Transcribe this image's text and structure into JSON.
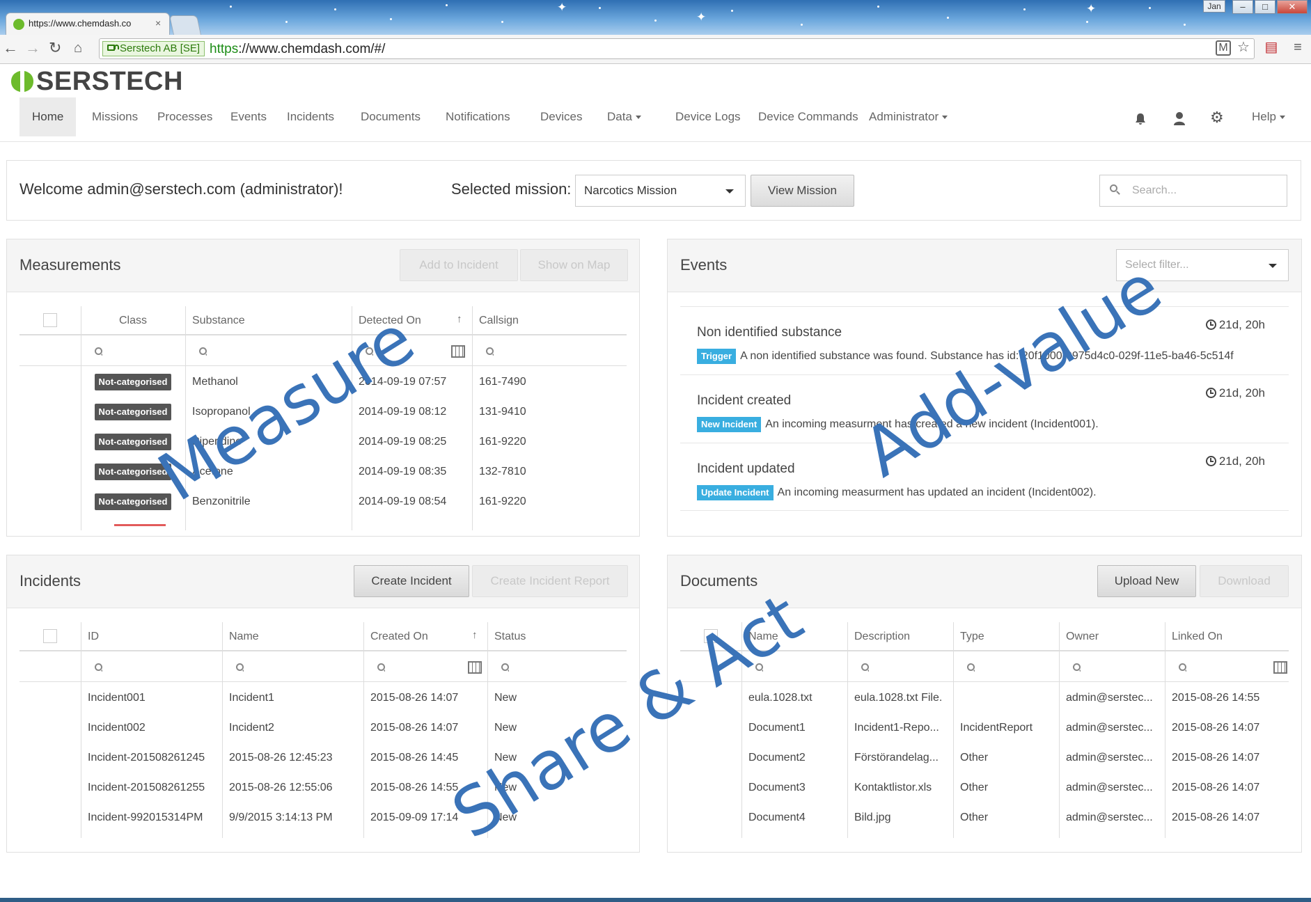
{
  "browser": {
    "tab_title": "https://www.chemdash.co",
    "tab_close": "×",
    "window_user": "Jan",
    "cert_label": "Serstech AB [SE]",
    "url_scheme": "https",
    "url_rest": "://www.chemdash.com/#/"
  },
  "app": {
    "logo_text": "SERSTECH",
    "brand_color": "#6dbb2c",
    "nav": [
      {
        "label": "Home",
        "active": true
      },
      {
        "label": "Missions"
      },
      {
        "label": "Processes"
      },
      {
        "label": "Events"
      },
      {
        "label": "Incidents"
      },
      {
        "label": "Documents"
      },
      {
        "label": "Notifications"
      },
      {
        "label": "Devices"
      },
      {
        "label": "Data",
        "dropdown": true
      },
      {
        "label": "Device Logs"
      },
      {
        "label": "Device Commands"
      },
      {
        "label": "Administrator",
        "dropdown": true
      }
    ],
    "help_label": "Help",
    "header_icons": [
      "bell-icon",
      "user-icon",
      "gear-icon"
    ]
  },
  "welcome": {
    "text": "Welcome admin@serstech.com (administrator)!",
    "mission_label": "Selected mission:",
    "mission_value": "Narcotics Mission",
    "view_mission": "View Mission",
    "search_placeholder": "Search..."
  },
  "measurements": {
    "title": "Measurements",
    "add_to_incident": "Add to Incident",
    "show_on_map": "Show on Map",
    "columns": [
      "Class",
      "Substance",
      "Detected On",
      "Callsign"
    ],
    "rows": [
      {
        "class": "Not-categorised",
        "substance": "Methanol",
        "detected": "2014-09-19 07:57",
        "callsign": "161-7490"
      },
      {
        "class": "Not-categorised",
        "substance": "Isopropanol",
        "detected": "2014-09-19 08:12",
        "callsign": "131-9410"
      },
      {
        "class": "Not-categorised",
        "substance": "Piperidine",
        "detected": "2014-09-19 08:25",
        "callsign": "161-9220"
      },
      {
        "class": "Not-categorised",
        "substance": "Acetone",
        "detected": "2014-09-19 08:35",
        "callsign": "132-7810"
      },
      {
        "class": "Not-categorised",
        "substance": "Benzonitrile",
        "detected": "2014-09-19 08:54",
        "callsign": "161-9220"
      }
    ]
  },
  "events": {
    "title": "Events",
    "filter_placeholder": "Select filter...",
    "items": [
      {
        "title": "Non identified substance",
        "time": "21d, 20h",
        "tag": "Trigger",
        "tag_color": "#39aee0",
        "desc": "A non identified substance was found. Substance has id: 20f1000-9975d4c0-029f-11e5-ba46-5c514f"
      },
      {
        "title": "Incident created",
        "time": "21d, 20h",
        "tag": "New Incident",
        "tag_color": "#39aee0",
        "desc": "An incoming measurment has created a new incident (Incident001)."
      },
      {
        "title": "Incident updated",
        "time": "21d, 20h",
        "tag": "Update Incident",
        "tag_color": "#39aee0",
        "desc": "An incoming measurment has updated an incident (Incident002)."
      }
    ]
  },
  "incidents": {
    "title": "Incidents",
    "create": "Create Incident",
    "create_report": "Create Incident Report",
    "columns": [
      "ID",
      "Name",
      "Created On",
      "Status"
    ],
    "rows": [
      {
        "id": "Incident001",
        "name": "Incident1",
        "created": "2015-08-26 14:07",
        "status": "New"
      },
      {
        "id": "Incident002",
        "name": "Incident2",
        "created": "2015-08-26 14:07",
        "status": "New"
      },
      {
        "id": "Incident-201508261245",
        "name": "2015-08-26 12:45:23",
        "created": "2015-08-26 14:45",
        "status": "New"
      },
      {
        "id": "Incident-201508261255",
        "name": "2015-08-26 12:55:06",
        "created": "2015-08-26 14:55",
        "status": "New"
      },
      {
        "id": "Incident-992015314PM",
        "name": "9/9/2015 3:14:13 PM",
        "created": "2015-09-09 17:14",
        "status": "New"
      }
    ]
  },
  "documents": {
    "title": "Documents",
    "upload": "Upload New",
    "download": "Download",
    "columns": [
      "Name",
      "Description",
      "Type",
      "Owner",
      "Linked On"
    ],
    "rows": [
      {
        "name": "eula.1028.txt",
        "desc": "eula.1028.txt File.",
        "type": "",
        "owner": "admin@serstec...",
        "linked": "2015-08-26 14:55"
      },
      {
        "name": "Document1",
        "desc": "Incident1-Repo...",
        "type": "IncidentReport",
        "owner": "admin@serstec...",
        "linked": "2015-08-26 14:07"
      },
      {
        "name": "Document2",
        "desc": "Förstörandelag...",
        "type": "Other",
        "owner": "admin@serstec...",
        "linked": "2015-08-26 14:07"
      },
      {
        "name": "Document3",
        "desc": "Kontaktlistor.xls",
        "type": "Other",
        "owner": "admin@serstec...",
        "linked": "2015-08-26 14:07"
      },
      {
        "name": "Document4",
        "desc": "Bild.jpg",
        "type": "Other",
        "owner": "admin@serstec...",
        "linked": "2015-08-26 14:07"
      }
    ]
  },
  "overlay": {
    "measure": "Measure",
    "add_value": "Add-value",
    "share_act": "Share & Act",
    "color": "#3a73b8"
  }
}
